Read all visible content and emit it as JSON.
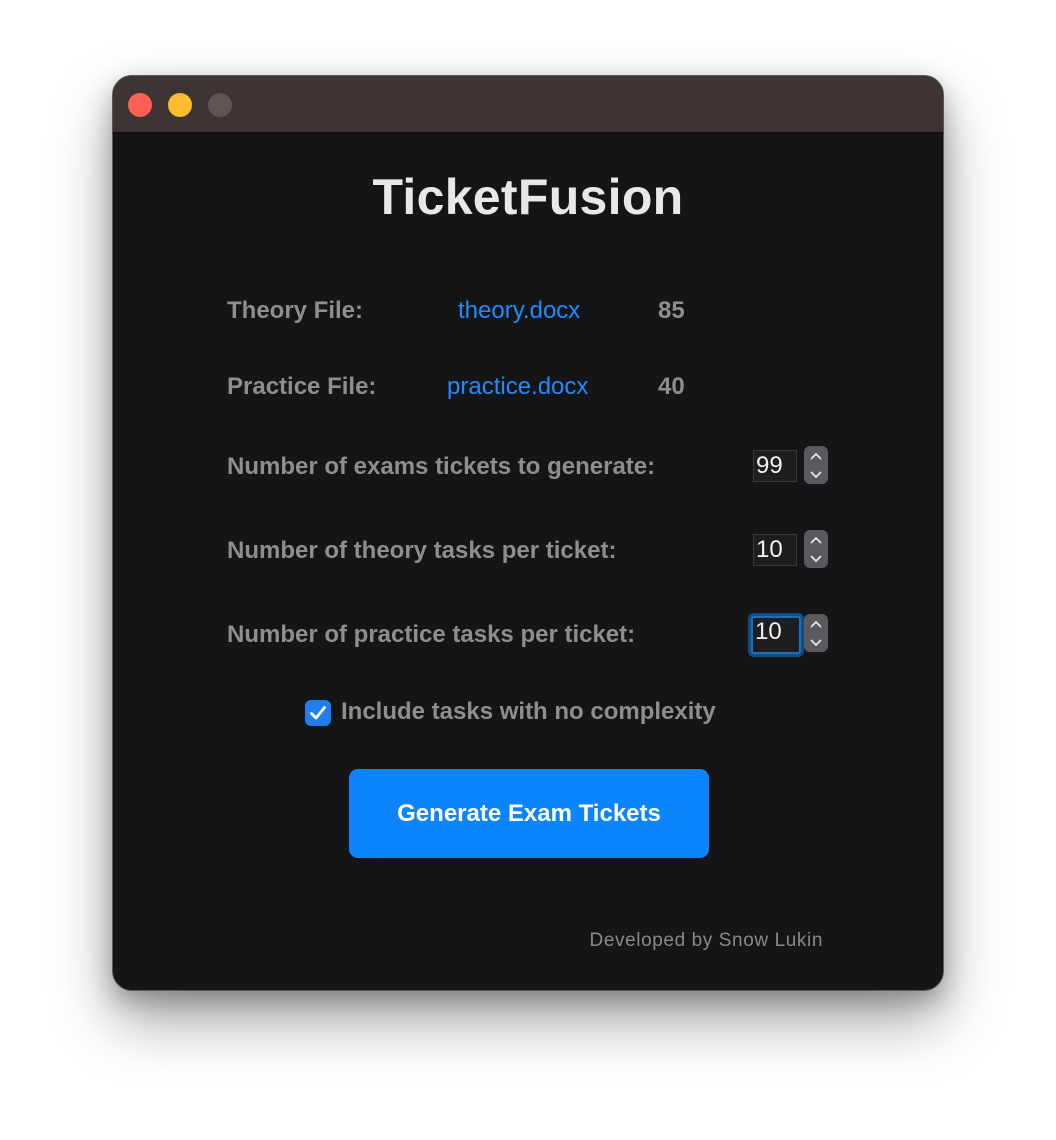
{
  "app": {
    "title": "TicketFusion"
  },
  "files": {
    "theory": {
      "label": "Theory File:",
      "filename": "theory.docx",
      "count": "85"
    },
    "practice": {
      "label": "Practice File:",
      "filename": "practice.docx",
      "count": "40"
    }
  },
  "settings": {
    "tickets": {
      "label": "Number of exams tickets to generate:",
      "value": "99"
    },
    "theory_tasks": {
      "label": "Number of theory tasks per ticket:",
      "value": "10"
    },
    "practice_tasks": {
      "label": "Number of practice tasks per ticket:",
      "value": "10"
    }
  },
  "options": {
    "include_no_complexity": {
      "label": "Include tasks with no complexity",
      "checked": true
    }
  },
  "actions": {
    "generate_label": "Generate Exam Tickets"
  },
  "footer": {
    "credit": "Developed by Snow Lukin"
  },
  "icons": {
    "window_close": "close-light",
    "window_minimize": "minimize-light",
    "window_maximize": "maximize-light",
    "stepper_up": "chevron-up-icon",
    "stepper_down": "chevron-down-icon",
    "checkbox": "checkmark-icon"
  },
  "colors": {
    "accent": "#0c84fe",
    "link": "#1f8bff",
    "close": "#fe5f57",
    "minimize": "#febc2e",
    "maximize": "#5d5554",
    "background": "#151517",
    "titlebar": "#3d3433"
  }
}
